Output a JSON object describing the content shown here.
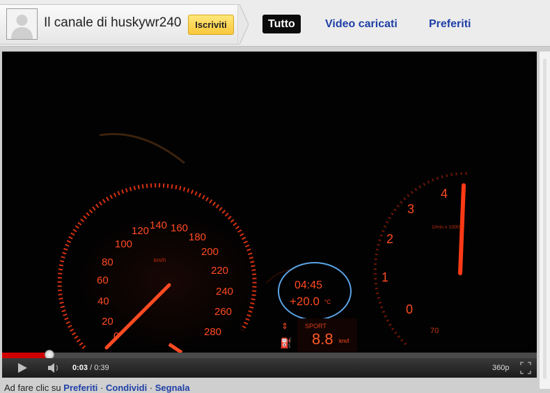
{
  "channel": {
    "title": "Il canale di huskywr240",
    "subscribe_label": "Iscriviti",
    "avatar_icon": "default-user-avatar"
  },
  "tabs": [
    {
      "label": "Tutto",
      "active": true
    },
    {
      "label": "Video caricati",
      "active": false
    },
    {
      "label": "Preferiti",
      "active": false
    }
  ],
  "video_frame": {
    "speedometer_ticks": [
      "0",
      "20",
      "40",
      "60",
      "80",
      "100",
      "120",
      "140",
      "160",
      "180",
      "200",
      "220",
      "240",
      "260",
      "280"
    ],
    "speed_unit": "km/h",
    "tachometer_ticks": [
      "0",
      "1",
      "2",
      "3",
      "4"
    ],
    "tach_unit": "1/min x 1000",
    "clock": "04:45",
    "temperature": "+20.0",
    "temperature_unit": "°C",
    "mode": "SPORT",
    "consumption": "8.8",
    "consumption_unit": "km/l",
    "gauge_70": "70"
  },
  "player": {
    "current_time": "0:03",
    "separator": " / ",
    "duration": "0:39",
    "quality": "360p",
    "progress_fraction": 0.088,
    "loaded_fraction": 0.088,
    "play_icon": "play-icon",
    "volume_icon": "volume-icon",
    "fullscreen_icon": "fullscreen-icon"
  },
  "info_line": {
    "prefix": "Ad fare clic su",
    "links": [
      "Preferiti",
      "Condividi",
      "Segnala"
    ]
  },
  "colors": {
    "tab_link": "#1f3fa6",
    "progress": "#d10000",
    "subscribe": "#f9c83a",
    "dash_orange": "#ff3a16"
  }
}
